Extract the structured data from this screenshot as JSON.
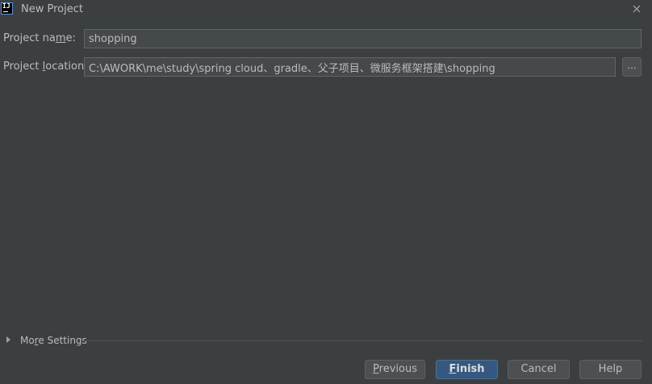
{
  "window": {
    "title": "New Project",
    "app_icon_text": "IJ"
  },
  "form": {
    "name_label_prefix": "Project na",
    "name_label_mnemonic": "m",
    "name_label_suffix": "e:",
    "name_value": "shopping",
    "location_label_prefix": "Project ",
    "location_label_mnemonic": "l",
    "location_label_suffix": "ocation:",
    "location_value": "C:\\AWORK\\me\\study\\spring cloud、gradle、父子项目、微服务框架搭建\\shopping",
    "browse_label": "..."
  },
  "more_settings": {
    "prefix": "Mo",
    "mnemonic": "r",
    "suffix": "e Settings"
  },
  "buttons": {
    "previous_mnemonic": "P",
    "previous_rest": "revious",
    "finish_mnemonic": "F",
    "finish_rest": "inish",
    "cancel": "Cancel",
    "help": "Help"
  },
  "colors": {
    "background": "#3c3f41",
    "field_background": "#45494a",
    "primary_button": "#365880"
  },
  "icons": {
    "app": "intellij-icon",
    "close": "close-icon",
    "expand": "triangle-right-icon"
  }
}
